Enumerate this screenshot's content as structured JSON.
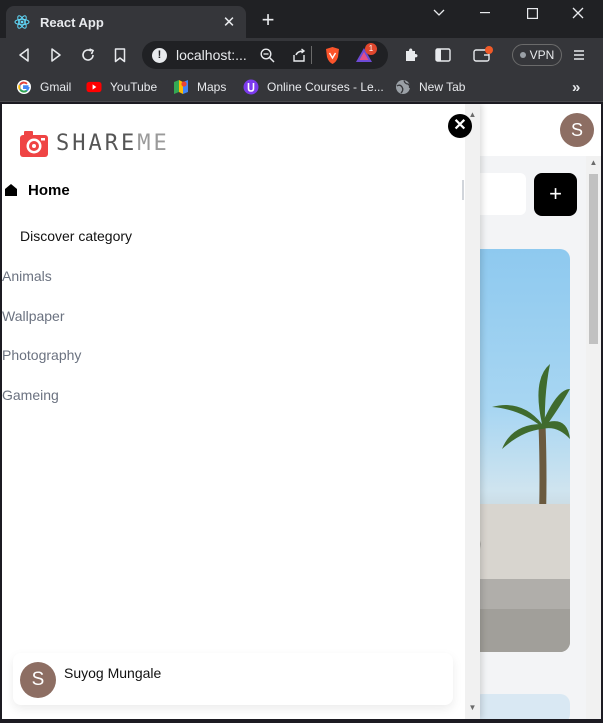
{
  "browser": {
    "tab_title": "React App",
    "tab_close": "✕",
    "new_tab": "+",
    "url": "localhost:...",
    "vpn_label": "VPN",
    "brave_badge": "1",
    "bookmarks": [
      {
        "label": "Gmail",
        "icon": "gmail-icon"
      },
      {
        "label": "YouTube",
        "icon": "youtube-icon"
      },
      {
        "label": "Maps",
        "icon": "maps-icon"
      },
      {
        "label": "Online Courses - Le...",
        "icon": "online-courses-icon"
      },
      {
        "label": "New Tab",
        "icon": "globe-icon"
      }
    ],
    "bookmarks_overflow": "»"
  },
  "sidebar": {
    "close": "✕",
    "logo_main": "SHARE",
    "logo_accent": "ME",
    "home_label": "Home",
    "discover_label": "Discover category",
    "categories": [
      "Animals",
      "Wallpaper",
      "Photography",
      "Gameing"
    ],
    "user": {
      "initial": "S",
      "name": "Suyog Mungale"
    }
  },
  "background": {
    "avatar_initial": "S",
    "create_button": "+"
  },
  "colors": {
    "logo_red": "#ef4444",
    "close_bg": "#000000",
    "avatar_bg": "#8d6e63"
  }
}
